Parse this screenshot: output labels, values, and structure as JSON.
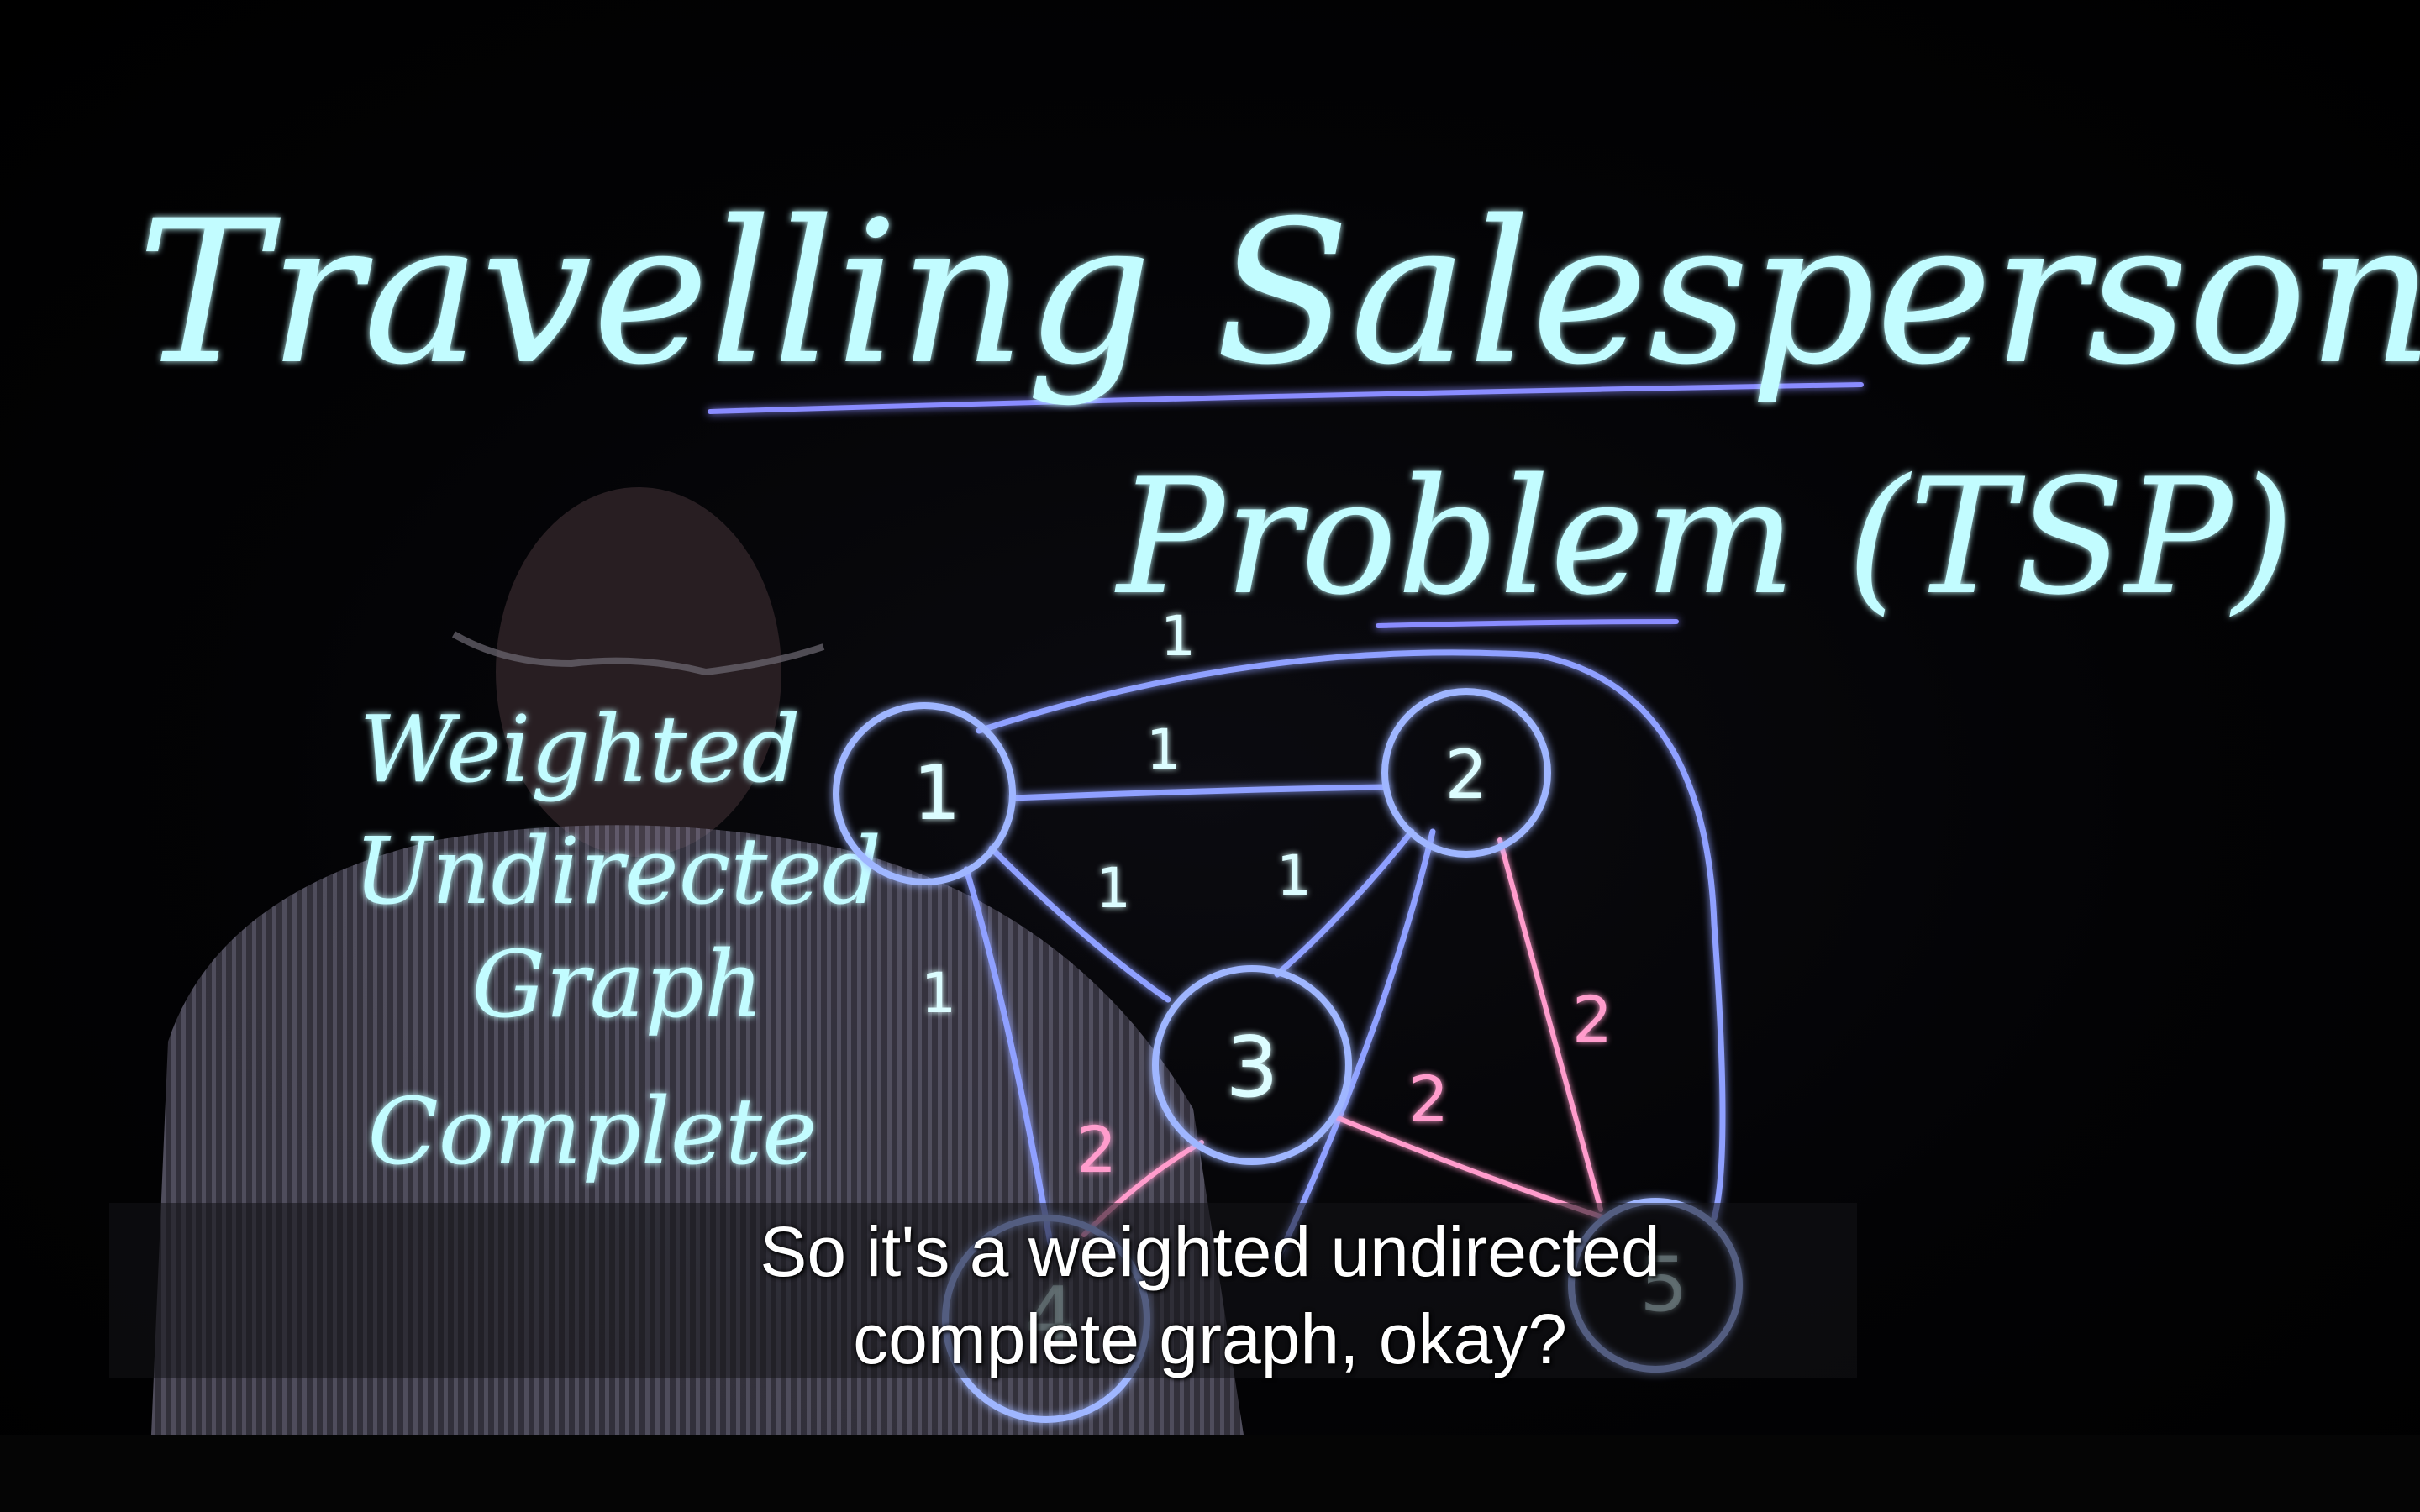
{
  "title": {
    "line1": "Travelling Salesperson",
    "line2": "Problem (TSP)"
  },
  "properties": [
    "Weighted",
    "Undirected",
    "Graph",
    "Complete"
  ],
  "graph": {
    "nodes": [
      "1",
      "2",
      "3",
      "4",
      "5"
    ],
    "edge_labels": {
      "e12": "1",
      "e15": "1",
      "e13": "1",
      "e23": "1",
      "e14": "1",
      "e25": "2",
      "e34": "2",
      "e35": "2"
    }
  },
  "subtitle": {
    "line1": "So it's a weighted undirected",
    "line2": "complete graph, okay?"
  },
  "colors": {
    "chalk_cyan": "#b8fbff",
    "chalk_blue": "#7a8cff",
    "chalk_pink": "#ff9ac8",
    "background": "#000000",
    "caption_text": "#ffffff"
  }
}
